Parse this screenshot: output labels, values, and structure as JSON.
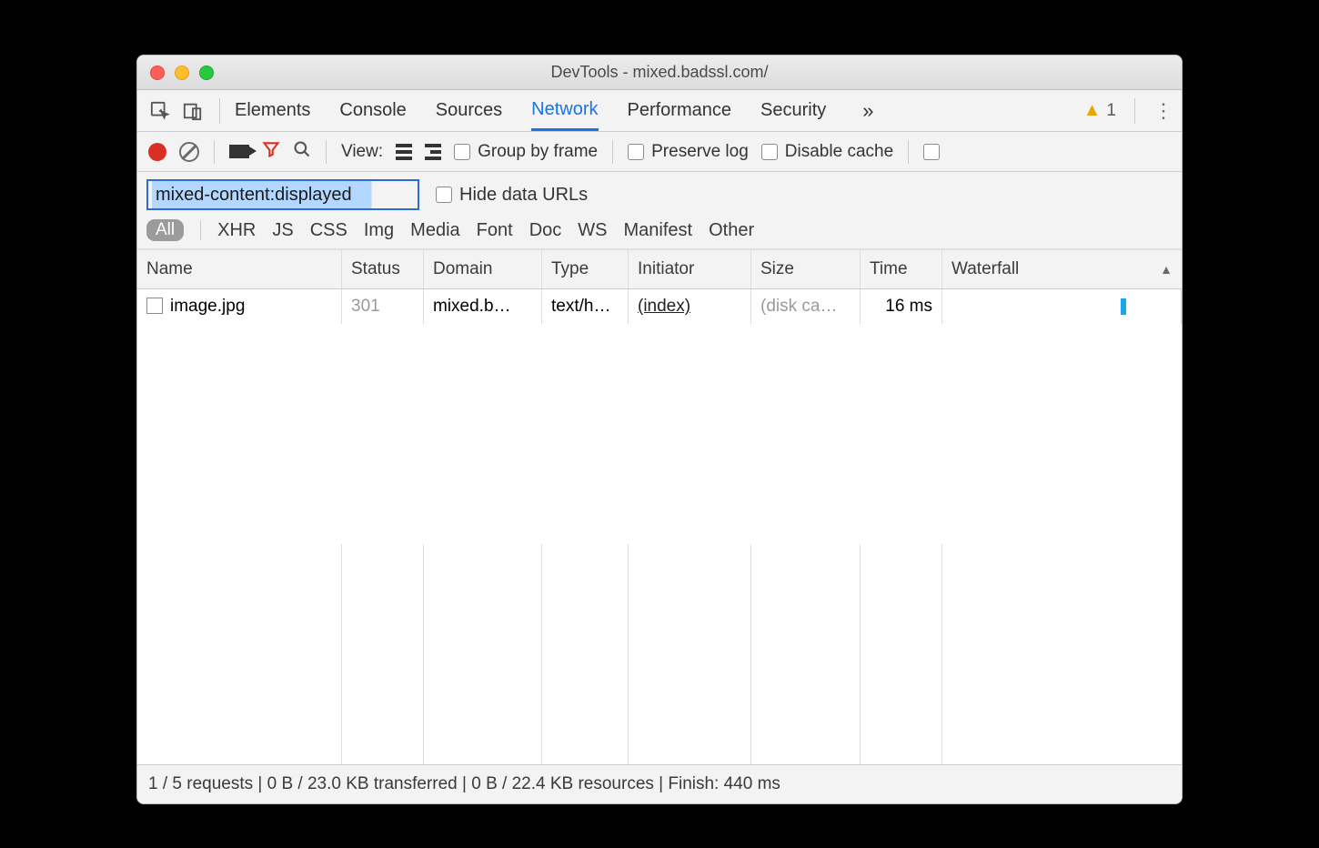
{
  "window": {
    "title": "DevTools - mixed.badssl.com/"
  },
  "tabs": {
    "items": [
      "Elements",
      "Console",
      "Sources",
      "Network",
      "Performance",
      "Security"
    ],
    "active": "Network",
    "overflow_glyph": "»",
    "warnings_count": "1"
  },
  "toolbar": {
    "view_label": "View:",
    "group_by_frame": "Group by frame",
    "preserve_log": "Preserve log",
    "disable_cache": "Disable cache"
  },
  "filter": {
    "input_value": "mixed-content:displayed",
    "hide_data_urls": "Hide data URLs",
    "pills": [
      "All",
      "XHR",
      "JS",
      "CSS",
      "Img",
      "Media",
      "Font",
      "Doc",
      "WS",
      "Manifest",
      "Other"
    ],
    "active_pill": "All"
  },
  "grid": {
    "columns": [
      "Name",
      "Status",
      "Domain",
      "Type",
      "Initiator",
      "Size",
      "Time",
      "Waterfall"
    ],
    "sort_column": "Waterfall",
    "sort_dir": "asc",
    "rows": [
      {
        "name": "image.jpg",
        "status": "301",
        "domain": "mixed.b…",
        "type": "text/h…",
        "initiator": "(index)",
        "size": "(disk ca…",
        "time": "16 ms"
      }
    ]
  },
  "status": {
    "text": "1 / 5 requests | 0 B / 23.0 KB transferred | 0 B / 22.4 KB resources | Finish: 440 ms"
  }
}
